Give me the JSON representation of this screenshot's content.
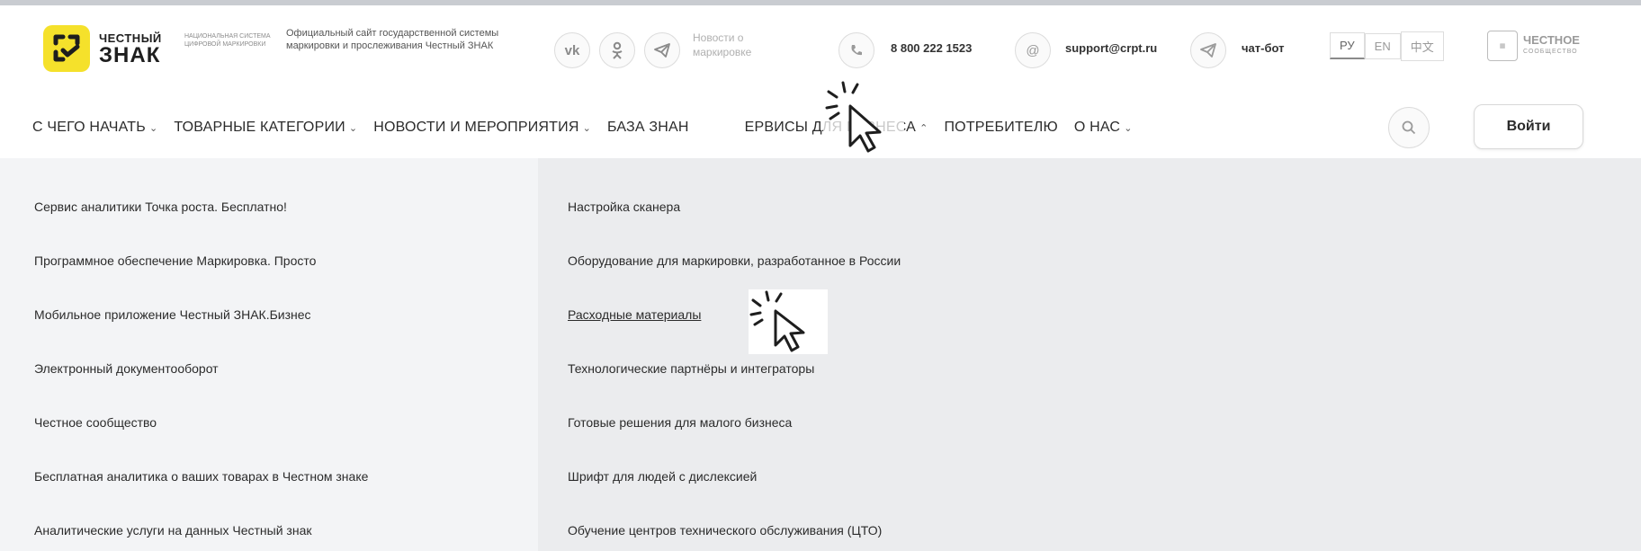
{
  "header": {
    "logo": {
      "line1": "ЧЕСТНЫЙ",
      "line2": "ЗНАК",
      "subtitle": "НАЦИОНАЛЬНАЯ СИСТЕМА ЦИФРОВОЙ МАРКИРОВКИ"
    },
    "official_text": "Официальный сайт государственной системы маркировки и прослеживания Честный ЗНАК",
    "social": [
      "vk-icon",
      "ok-icon",
      "telegram-icon"
    ],
    "news_link": "Новости о маркировке",
    "phone": "8 800 222 1523",
    "email": "support@crpt.ru",
    "chatbot": "чат-бот",
    "languages": [
      "РУ",
      "EN",
      "中文"
    ],
    "active_language": "РУ",
    "community": {
      "line1": "ЧЕСТНОЕ",
      "line2": "СООБЩЕСТВО"
    }
  },
  "nav": {
    "items": [
      {
        "label": "С ЧЕГО НАЧАТЬ",
        "chevron": "⌄"
      },
      {
        "label": "ТОВАРНЫЕ КАТЕГОРИИ",
        "chevron": "⌄"
      },
      {
        "label": "НОВОСТИ И МЕРОПРИЯТИЯ",
        "chevron": "⌄"
      },
      {
        "label": "БАЗА ЗНАН",
        "chevron": ""
      },
      {
        "label": "ЕРВИСЫ ДЛЯ БИЗНЕСА",
        "chevron": "⌃"
      },
      {
        "label": "ПОТРЕБИТЕЛЮ",
        "chevron": ""
      },
      {
        "label": "О НАС",
        "chevron": "⌄"
      }
    ],
    "login_label": "Войти"
  },
  "dropdown": {
    "left": [
      "Сервис аналитики Точка роста. Бесплатно!",
      "Программное обеспечение Маркировка. Просто",
      "Мобильное приложение Честный ЗНАК.Бизнес",
      "Электронный документооборот",
      "Честное сообщество",
      "Бесплатная аналитика о ваших товарах в Честном знаке",
      "Аналитические услуги на данных Честный знак"
    ],
    "right": [
      "Настройка сканера",
      "Оборудование для маркировки, разработанное в России",
      "Расходные материалы",
      "Технологические партнёры и интеграторы",
      "Готовые решения для малого бизнеса",
      "Шрифт для людей с дислексией",
      "Обучение центров технического обслуживания (ЦТО)"
    ]
  },
  "colors": {
    "brand_yellow": "#f5e12b",
    "left_panel": "#f3f4f6",
    "right_panel": "#ebecee"
  }
}
